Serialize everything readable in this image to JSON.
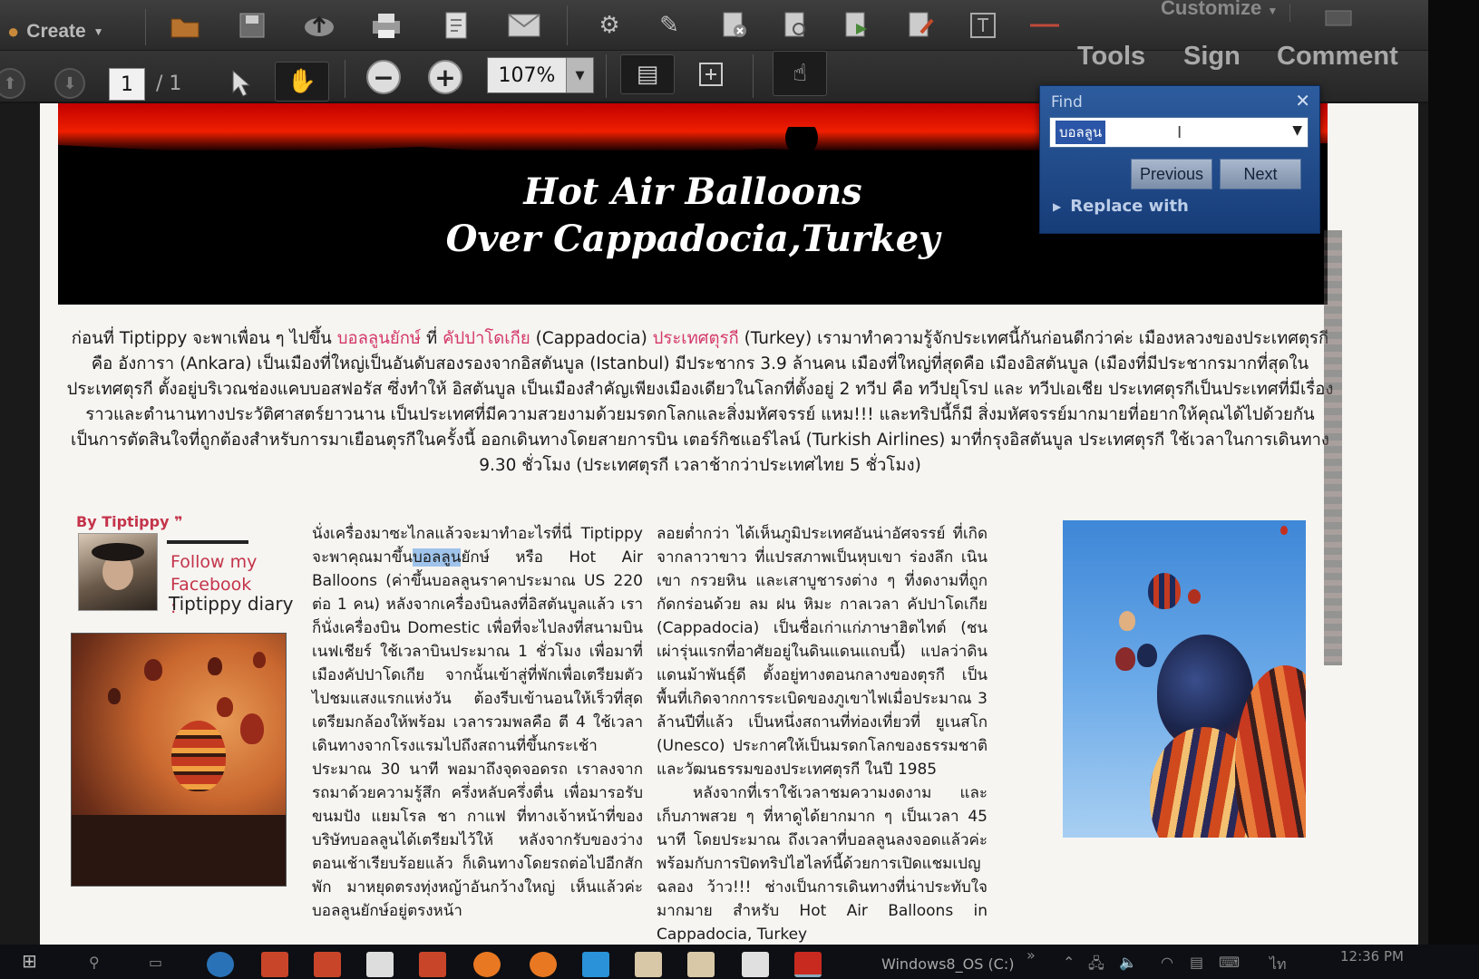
{
  "toolbar": {
    "create_label": "Create",
    "customize_label": "Customize",
    "page_current": "1",
    "page_total": "/ 1",
    "zoom_value": "107%",
    "tools_label": "Tools",
    "sign_label": "Sign",
    "comment_label": "Comment",
    "icons": [
      "open-folder-icon",
      "save-icon",
      "cloud-upload-icon",
      "print-icon",
      "edit-document-icon",
      "email-icon",
      "gear-icon",
      "annotate-icon",
      "redact-icon",
      "protect-icon",
      "export-icon",
      "edit-text-icon",
      "text-box-icon"
    ]
  },
  "document": {
    "banner_title_line1": "Hot Air Balloons",
    "banner_title_line2": "Over Cappadocia,Turkey",
    "intro": [
      {
        "t": "ก่อนที่ Tiptippy จะพาเพื่อน ๆ ไปขึ้น "
      },
      {
        "t": "บอลลูนยักษ์",
        "pink": true
      },
      {
        "t": " ที่ "
      },
      {
        "t": "คัปปาโดเกีย",
        "pink": true
      },
      {
        "t": " (Cappadocia) "
      },
      {
        "t": "ประเทศตุรกี",
        "pink": true
      },
      {
        "t": " (Turkey) เรามาทำความรู้จักประเทศนี้กันก่อนดีกว่าค่ะ เมืองหลวงของประเทศตุรกี คือ อังการา (Ankara) เป็นเมืองที่ใหญ่เป็นอันดับสองรองจากอิสตันบูล (Istanbul) มีประชากร 3.9 ล้านคน เมืองที่ใหญ่ที่สุดคือ เมืองอิสตันบูล (เมืองที่มีประชากรมากที่สุดในประเทศตุรกี ตั้งอยู่บริเวณช่องแคบบอสฟอรัส ซึ่งทำให้ อิสตันบูล เป็นเมืองสำคัญเพียงเมืองเดียวในโลกที่ตั้งอยู่ 2 ทวีป คือ ทวีปยุโรป และ ทวีปเอเชีย ประเทศตุรกีเป็นประเทศที่มีเรื่องราวและตำนานทางประวัติศาสตร์ยาวนาน เป็นประเทศที่มีความสวยงามด้วยมรดกโลกและสิ่งมหัศจรรย์ แหม!!! และทริปนี้ก็มี สิ่งมหัศจรรย์มากมายที่อยากให้คุณได้ไปด้วยกัน เป็นการตัดสินใจที่ถูกต้องสำหรับการมาเยือนตุรกีในครั้งนี้ ออกเดินทางโดยสายการบิน เตอร์กิชแอร์ไลน์ (Turkish Airlines) มาที่กรุงอิสตันบูล ประเทศตุรกี ใช้เวลาในการเดินทาง 9.30 ชั่วโมง (ประเทศตุรกี เวลาช้ากว่าประเทศไทย 5 ชั่วโมง)"
      }
    ],
    "byline": "By Tiptippy ❞",
    "follow_text": "Follow my Facebook :",
    "diary_text": "Tiptippy diary",
    "col1_before": "นั่งเครื่องมาซะไกลแล้วจะมาทำอะไรที่นี่ Tiptippy จะพาคุณมาขึ้น",
    "col1_highlight": "บอลลูน",
    "col1_after": "ยักษ์ หรือ Hot Air Balloons (ค่าขึ้นบอลลูนราคาประมาณ US 220 ต่อ 1 คน) หลังจากเครื่องบินลงที่อิสตันบูลแล้ว เราก็นั่งเครื่องบิน Domestic เพื่อที่จะไปลงที่สนามบินเนฟเชียร์ ใช้เวลาบินประมาณ 1 ชั่วโมง เพื่อมาที่เมืองคัปปาโดเกีย จากนั้นเข้าสู่ที่พักเพื่อเตรียมตัวไปชมแสงแรกแห่งวัน ต้องรีบเข้านอนให้เร็วที่สุด เตรียมกล้องให้พร้อม เวลารวมพลคือ ตี 4 ใช้เวลาเดินทางจากโรงแรมไปถึงสถานที่ขึ้นกระเช้า ประมาณ 30 นาที พอมาถึงจุดจอดรถ เราลงจากรถมาด้วยความรู้สึก ครึ่งหลับครึ่งตื่น เพื่อมารอรับขนมปัง แยมโรล ชา กาแฟ ที่ทางเจ้าหน้าที่ของบริษัทบอลลูนได้เตรียมไว้ให้ หลังจากรับของว่างตอนเช้าเรียบร้อยแล้ว ก็เดินทางโดยรถต่อไปอีกสักพัก มาหยุดตรงทุ่งหญ้าอันกว้างใหญ่ เห็นแล้วค่ะ บอลลูนยักษ์อยู่ตรงหน้า",
    "col2_text": "ลอยต่ำกว่า ได้เห็นภูมิประเทศอันน่าอัศจรรย์ ที่เกิดจากลาวาขาว ที่แปรสภาพเป็นหุบเขา ร่องลึก เนินเขา กรวยหิน และเสาบูชารงต่าง ๆ ที่งดงามที่ถูกกัดกร่อนด้วย ลม ฝน หิมะ กาลเวลา คัปปาโดเกีย (Cappadocia) เป็นชื่อเก่าแก่ภาษาฮิตไทต์ (ชนเผ่ารุ่นแรกที่อาศัยอยู่ในดินแดนแถบนี้) แปลว่าดินแดนม้าพันธุ์ดี ตั้งอยู่ทางตอนกลางของตุรกี เป็นพื้นที่เกิดจากการระเบิดของภูเขาไฟเมื่อประมาณ 3 ล้านปีที่แล้ว เป็นหนึ่งสถานที่ท่องเที่ยวที่ ยูเนสโก (Unesco) ประกาศให้เป็นมรดกโลกของธรรมชาติและวัฒนธรรมของประเทศตุรกี ในปี 1985",
    "col2_text_b": "หลังจากที่เราใช้เวลาชมความงดงาม และเก็บภาพสวย ๆ ที่หาดูได้ยากมาก ๆ เป็นเวลา 45 นาที โดยประมาณ ถึงเวลาที่บอลลูนลงจอดแล้วค่ะ พร้อมกับการปิดทริปไฮไลท์นี้ด้วยการเปิดแชมเปญฉลอง ว้าว!!! ช่างเป็นการเดินทางที่น่าประทับใจมากมาย สำหรับ Hot Air Balloons in Cappadocia, Turkey"
  },
  "find": {
    "label": "Find",
    "query": "บอลลูน",
    "previous_label": "Previous",
    "next_label": "Next",
    "replace_label": "Replace with"
  },
  "taskbar": {
    "drive_label": "Windows8_OS (C:)",
    "clock": "12:36 PM"
  },
  "colors": {
    "accent_pink": "#d4386a",
    "find_blue": "#2d5c9e",
    "highlight": "#9fc3ea"
  }
}
